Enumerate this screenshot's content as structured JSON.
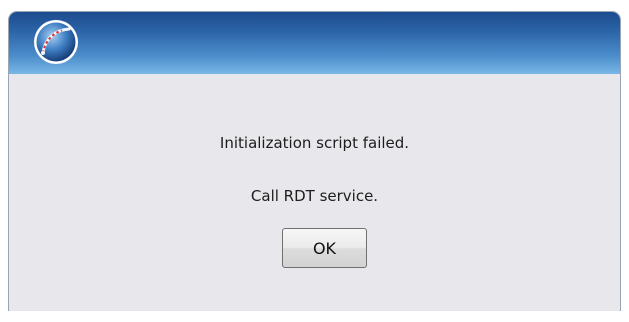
{
  "dialog": {
    "icon": "gauge-dial-icon",
    "message_line1": "Initialization script failed.",
    "message_line2": "Call RDT service.",
    "ok_label": "OK"
  },
  "colors": {
    "titlebar_dark": "#1c4c8e",
    "titlebar_light": "#79b7e6",
    "dialog_body": "#e8e8ec"
  }
}
